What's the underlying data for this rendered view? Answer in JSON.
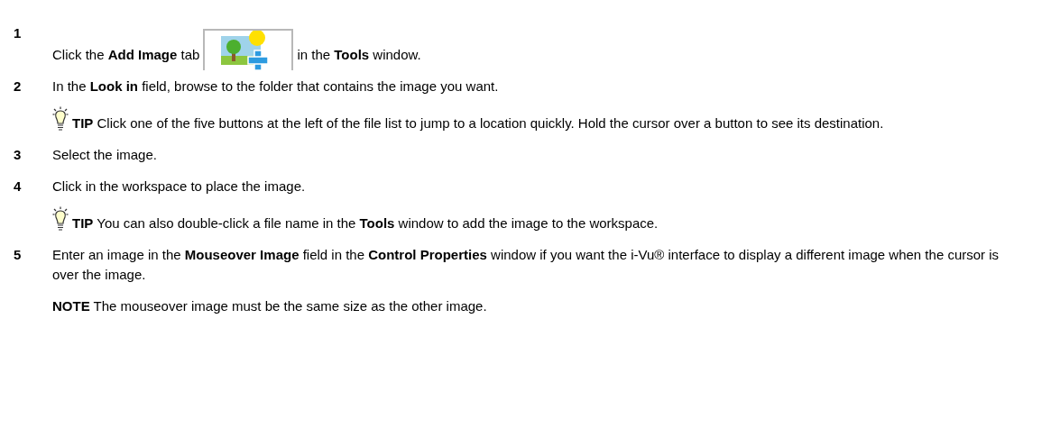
{
  "items": [
    {
      "kind": "step",
      "number": "1",
      "text": "Click the **Add Image** tab",
      "text_after": "in the **Tools** window."
    },
    {
      "kind": "step",
      "number": "2",
      "text": "In the **Look in** field, browse to the folder that contains the image you want."
    },
    {
      "kind": "tip",
      "label": "TIP",
      "text": "Click one of the five buttons at the left of the file list to jump to a location quickly. Hold the cursor over a button to see its destination."
    },
    {
      "kind": "step",
      "number": "3",
      "text": "Select the image."
    },
    {
      "kind": "step",
      "number": "4",
      "text": "Click in the workspace to place the image."
    },
    {
      "kind": "tip",
      "label": "TIP",
      "text": "You can also double-click a file name in the **Tools** window to add the image to the workspace."
    },
    {
      "kind": "step",
      "number": "5",
      "text": "Enter an image in the **Mouseover Image** field in the **Control Properties** window if you want the i-Vu® interface to display a different image when the cursor is over the image."
    },
    {
      "kind": "note",
      "label": "NOTE",
      "text": "The mouseover image must be the same size as the other image."
    }
  ]
}
